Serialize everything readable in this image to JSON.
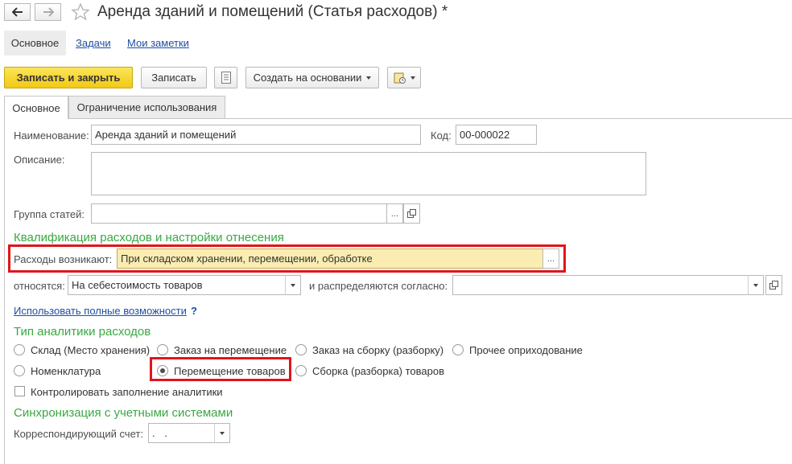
{
  "window": {
    "title": "Аренда зданий и помещений (Статья расходов) *"
  },
  "nav": {
    "back_icon": "arrow-left-icon",
    "forward_icon": "arrow-right-icon",
    "favorite_icon": "star-icon"
  },
  "section_tabs": [
    "Основное",
    "Задачи",
    "Мои заметки"
  ],
  "toolbar": {
    "save_close": "Записать и закрыть",
    "save": "Записать",
    "create_based": "Создать на основании",
    "list_icon": "list-icon",
    "report_icon": "report-settings-icon"
  },
  "form_tabs": [
    "Основное",
    "Ограничение использования"
  ],
  "form": {
    "name_label": "Наименование:",
    "name_value": "Аренда зданий и помещений",
    "code_label": "Код:",
    "code_value": "00-000022",
    "description_label": "Описание:",
    "description_value": "",
    "group_label": "Группа статей:",
    "group_value": "",
    "choose_btn": "...",
    "open_icon": "open-window-icon"
  },
  "qualification": {
    "title": "Квалификация расходов и настройки отнесения",
    "arise_label": "Расходы возникают:",
    "arise_value": "При складском хранении, перемещении, обработке",
    "relate_label": "относятся:",
    "relate_value": "На себестоимость товаров",
    "distribute_label": "и распределяются согласно:",
    "distribute_value": "",
    "full_link": "Использовать полные возможности",
    "help": "?"
  },
  "analytics": {
    "title": "Тип аналитики расходов",
    "options": [
      "Склад (Место хранения)",
      "Заказ на перемещение",
      "Заказ на сборку (разборку)",
      "Прочее оприходование",
      "Номенклатура",
      "Перемещение товаров",
      "Сборка (разборка) товаров"
    ],
    "selected": "Перемещение товаров",
    "control_label": "Контролировать заполнение аналитики"
  },
  "sync": {
    "title": "Синхронизация с учетными системами",
    "account_label": "Корреспондирующий счет:",
    "account_value": ". ."
  },
  "colors": {
    "accent_green": "#3aa843",
    "primary_button": "#f2c914",
    "highlight_red": "#e0151b",
    "yellow_field": "#fbedb1",
    "link_blue": "#1d4fa5"
  }
}
